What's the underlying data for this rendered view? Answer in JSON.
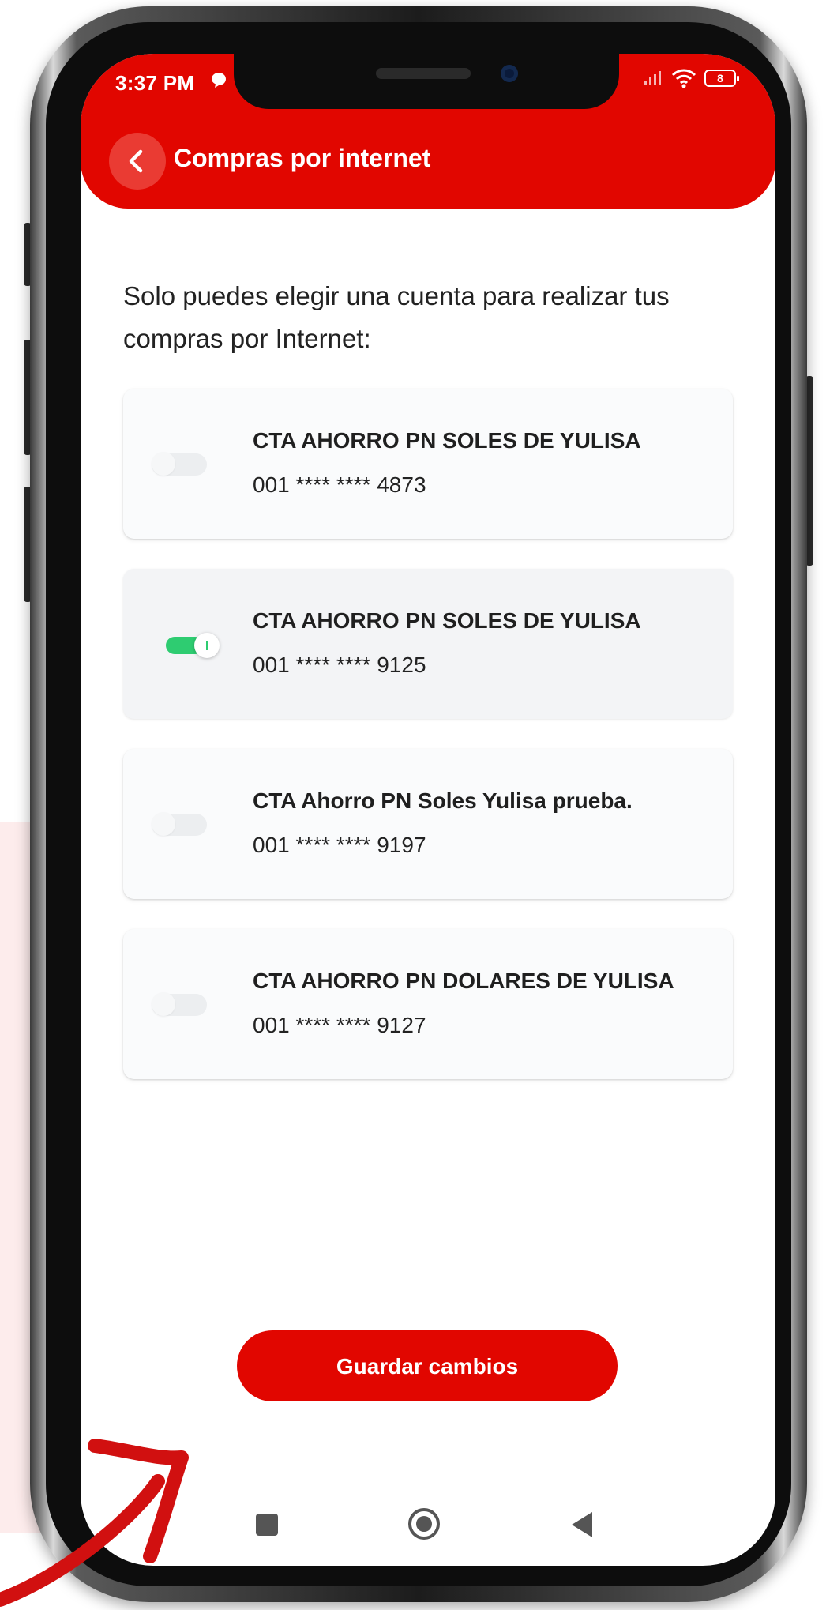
{
  "status_bar": {
    "time": "3:37 PM",
    "battery": "8"
  },
  "header": {
    "title": "Compras por internet",
    "background_color": "#e10600"
  },
  "intro_text": "Solo puedes elegir una cuenta para realizar tus compras por Internet:",
  "accounts": [
    {
      "name": "CTA AHORRO PN SOLES DE YULISA",
      "number": "001 **** **** 4873",
      "enabled": false
    },
    {
      "name": "CTA AHORRO PN SOLES DE YULISA",
      "number": "001 **** **** 9125",
      "enabled": true
    },
    {
      "name": "CTA Ahorro PN Soles Yulisa prueba.",
      "number": "001 **** **** 9197",
      "enabled": false
    },
    {
      "name": "CTA AHORRO PN DOLARES DE YULISA",
      "number": "001 **** **** 9127",
      "enabled": false
    }
  ],
  "save_button": {
    "label": "Guardar cambios"
  },
  "colors": {
    "accent": "#e10600",
    "toggle_on": "#2ecc71"
  },
  "icons": {
    "back": "chevron-left-icon",
    "nav_recent": "square-icon",
    "nav_home": "circle-icon",
    "nav_back": "triangle-left-icon"
  }
}
